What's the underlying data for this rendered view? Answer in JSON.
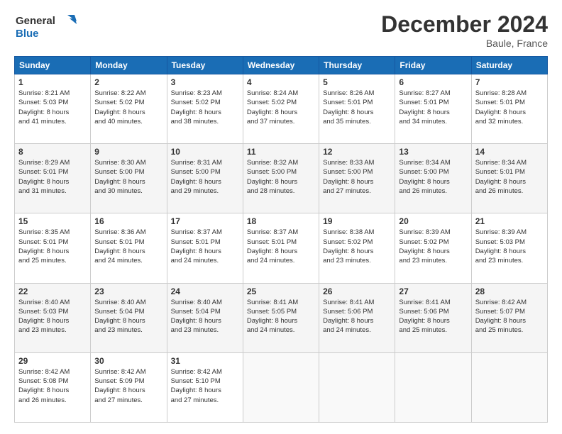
{
  "header": {
    "logo_line1": "General",
    "logo_line2": "Blue",
    "month": "December 2024",
    "location": "Baule, France"
  },
  "weekdays": [
    "Sunday",
    "Monday",
    "Tuesday",
    "Wednesday",
    "Thursday",
    "Friday",
    "Saturday"
  ],
  "rows": [
    [
      {
        "day": "1",
        "lines": [
          "Sunrise: 8:21 AM",
          "Sunset: 5:03 PM",
          "Daylight: 8 hours",
          "and 41 minutes."
        ]
      },
      {
        "day": "2",
        "lines": [
          "Sunrise: 8:22 AM",
          "Sunset: 5:02 PM",
          "Daylight: 8 hours",
          "and 40 minutes."
        ]
      },
      {
        "day": "3",
        "lines": [
          "Sunrise: 8:23 AM",
          "Sunset: 5:02 PM",
          "Daylight: 8 hours",
          "and 38 minutes."
        ]
      },
      {
        "day": "4",
        "lines": [
          "Sunrise: 8:24 AM",
          "Sunset: 5:02 PM",
          "Daylight: 8 hours",
          "and 37 minutes."
        ]
      },
      {
        "day": "5",
        "lines": [
          "Sunrise: 8:26 AM",
          "Sunset: 5:01 PM",
          "Daylight: 8 hours",
          "and 35 minutes."
        ]
      },
      {
        "day": "6",
        "lines": [
          "Sunrise: 8:27 AM",
          "Sunset: 5:01 PM",
          "Daylight: 8 hours",
          "and 34 minutes."
        ]
      },
      {
        "day": "7",
        "lines": [
          "Sunrise: 8:28 AM",
          "Sunset: 5:01 PM",
          "Daylight: 8 hours",
          "and 32 minutes."
        ]
      }
    ],
    [
      {
        "day": "8",
        "lines": [
          "Sunrise: 8:29 AM",
          "Sunset: 5:01 PM",
          "Daylight: 8 hours",
          "and 31 minutes."
        ]
      },
      {
        "day": "9",
        "lines": [
          "Sunrise: 8:30 AM",
          "Sunset: 5:00 PM",
          "Daylight: 8 hours",
          "and 30 minutes."
        ]
      },
      {
        "day": "10",
        "lines": [
          "Sunrise: 8:31 AM",
          "Sunset: 5:00 PM",
          "Daylight: 8 hours",
          "and 29 minutes."
        ]
      },
      {
        "day": "11",
        "lines": [
          "Sunrise: 8:32 AM",
          "Sunset: 5:00 PM",
          "Daylight: 8 hours",
          "and 28 minutes."
        ]
      },
      {
        "day": "12",
        "lines": [
          "Sunrise: 8:33 AM",
          "Sunset: 5:00 PM",
          "Daylight: 8 hours",
          "and 27 minutes."
        ]
      },
      {
        "day": "13",
        "lines": [
          "Sunrise: 8:34 AM",
          "Sunset: 5:00 PM",
          "Daylight: 8 hours",
          "and 26 minutes."
        ]
      },
      {
        "day": "14",
        "lines": [
          "Sunrise: 8:34 AM",
          "Sunset: 5:01 PM",
          "Daylight: 8 hours",
          "and 26 minutes."
        ]
      }
    ],
    [
      {
        "day": "15",
        "lines": [
          "Sunrise: 8:35 AM",
          "Sunset: 5:01 PM",
          "Daylight: 8 hours",
          "and 25 minutes."
        ]
      },
      {
        "day": "16",
        "lines": [
          "Sunrise: 8:36 AM",
          "Sunset: 5:01 PM",
          "Daylight: 8 hours",
          "and 24 minutes."
        ]
      },
      {
        "day": "17",
        "lines": [
          "Sunrise: 8:37 AM",
          "Sunset: 5:01 PM",
          "Daylight: 8 hours",
          "and 24 minutes."
        ]
      },
      {
        "day": "18",
        "lines": [
          "Sunrise: 8:37 AM",
          "Sunset: 5:01 PM",
          "Daylight: 8 hours",
          "and 24 minutes."
        ]
      },
      {
        "day": "19",
        "lines": [
          "Sunrise: 8:38 AM",
          "Sunset: 5:02 PM",
          "Daylight: 8 hours",
          "and 23 minutes."
        ]
      },
      {
        "day": "20",
        "lines": [
          "Sunrise: 8:39 AM",
          "Sunset: 5:02 PM",
          "Daylight: 8 hours",
          "and 23 minutes."
        ]
      },
      {
        "day": "21",
        "lines": [
          "Sunrise: 8:39 AM",
          "Sunset: 5:03 PM",
          "Daylight: 8 hours",
          "and 23 minutes."
        ]
      }
    ],
    [
      {
        "day": "22",
        "lines": [
          "Sunrise: 8:40 AM",
          "Sunset: 5:03 PM",
          "Daylight: 8 hours",
          "and 23 minutes."
        ]
      },
      {
        "day": "23",
        "lines": [
          "Sunrise: 8:40 AM",
          "Sunset: 5:04 PM",
          "Daylight: 8 hours",
          "and 23 minutes."
        ]
      },
      {
        "day": "24",
        "lines": [
          "Sunrise: 8:40 AM",
          "Sunset: 5:04 PM",
          "Daylight: 8 hours",
          "and 23 minutes."
        ]
      },
      {
        "day": "25",
        "lines": [
          "Sunrise: 8:41 AM",
          "Sunset: 5:05 PM",
          "Daylight: 8 hours",
          "and 24 minutes."
        ]
      },
      {
        "day": "26",
        "lines": [
          "Sunrise: 8:41 AM",
          "Sunset: 5:06 PM",
          "Daylight: 8 hours",
          "and 24 minutes."
        ]
      },
      {
        "day": "27",
        "lines": [
          "Sunrise: 8:41 AM",
          "Sunset: 5:06 PM",
          "Daylight: 8 hours",
          "and 25 minutes."
        ]
      },
      {
        "day": "28",
        "lines": [
          "Sunrise: 8:42 AM",
          "Sunset: 5:07 PM",
          "Daylight: 8 hours",
          "and 25 minutes."
        ]
      }
    ],
    [
      {
        "day": "29",
        "lines": [
          "Sunrise: 8:42 AM",
          "Sunset: 5:08 PM",
          "Daylight: 8 hours",
          "and 26 minutes."
        ]
      },
      {
        "day": "30",
        "lines": [
          "Sunrise: 8:42 AM",
          "Sunset: 5:09 PM",
          "Daylight: 8 hours",
          "and 27 minutes."
        ]
      },
      {
        "day": "31",
        "lines": [
          "Sunrise: 8:42 AM",
          "Sunset: 5:10 PM",
          "Daylight: 8 hours",
          "and 27 minutes."
        ]
      },
      null,
      null,
      null,
      null
    ]
  ]
}
